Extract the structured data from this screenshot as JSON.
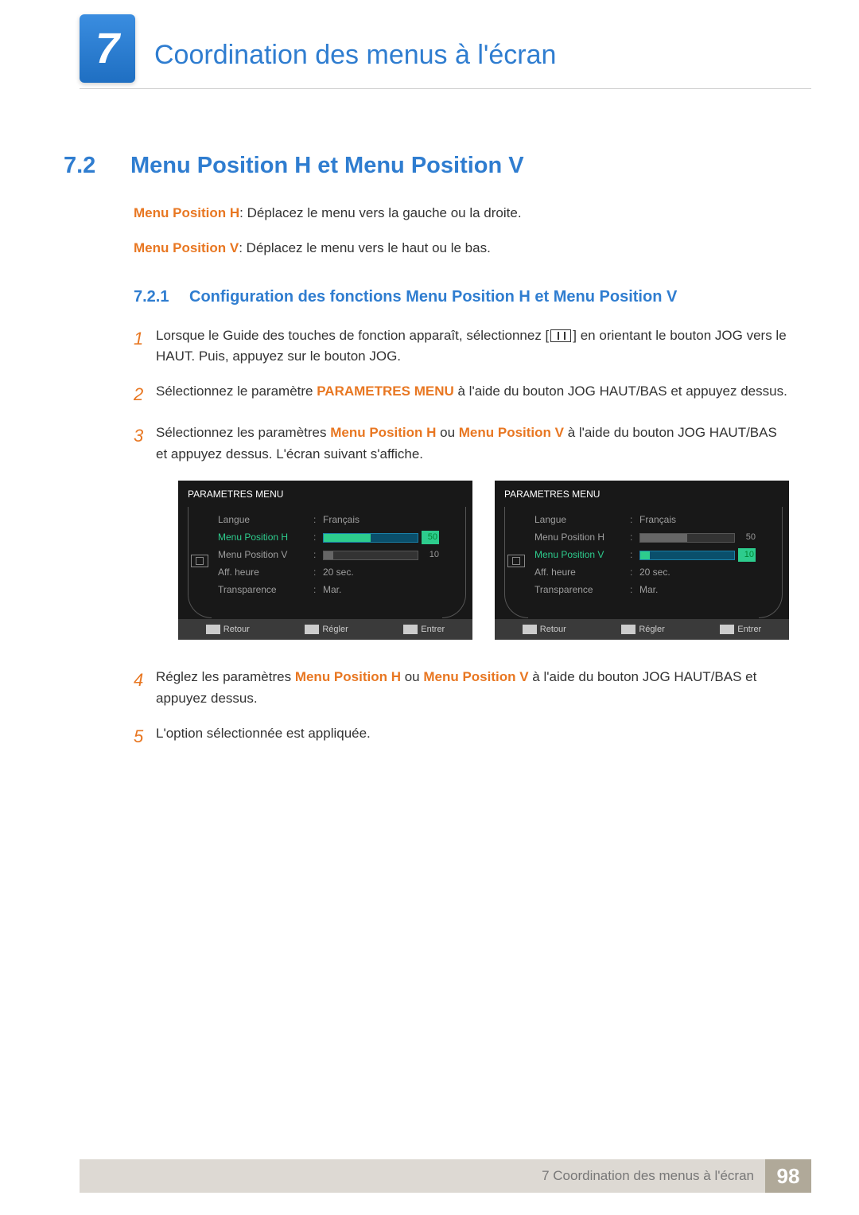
{
  "chapter": {
    "number": "7",
    "title": "Coordination des menus à l'écran"
  },
  "section": {
    "number": "7.2",
    "title": "Menu Position H et Menu Position V"
  },
  "defs": {
    "h_label": "Menu Position H",
    "h_text": ": Déplacez le menu vers la gauche ou la droite.",
    "v_label": "Menu Position V",
    "v_text": ": Déplacez le menu vers le haut ou le bas."
  },
  "subsection": {
    "number": "7.2.1",
    "title": "Configuration des fonctions Menu Position H et Menu Position V"
  },
  "steps": {
    "s1a": "Lorsque le Guide des touches de fonction apparaît, sélectionnez [",
    "s1b": "] en orientant le bouton JOG vers le HAUT. Puis, appuyez sur le bouton JOG.",
    "s2a": "Sélectionnez le paramètre ",
    "s2b": "PARAMETRES MENU",
    "s2c": " à l'aide du bouton JOG HAUT/BAS et appuyez dessus.",
    "s3a": "Sélectionnez les paramètres ",
    "s3b": "Menu Position H",
    "s3c": " ou ",
    "s3d": "Menu Position V",
    "s3e": " à l'aide du bouton JOG HAUT/BAS et appuyez dessus. L'écran suivant s'affiche.",
    "s4a": "Réglez les paramètres ",
    "s4b": "Menu Position H",
    "s4c": " ou ",
    "s4d": "Menu Position V",
    "s4e": " à l'aide du bouton JOG HAUT/BAS et appuyez dessus.",
    "s5": "L'option sélectionnée est appliquée."
  },
  "osd": {
    "title": "PARAMETRES MENU",
    "rows": {
      "langue": "Langue",
      "h": "Menu Position H",
      "v": "Menu Position V",
      "aff": "Aff. heure",
      "trans": "Transparence"
    },
    "values": {
      "langue": "Français",
      "h": "50",
      "v": "10",
      "aff": "20 sec.",
      "trans": "Mar."
    },
    "footer": {
      "retour": "Retour",
      "regler": "Régler",
      "entrer": "Entrer"
    }
  },
  "footer": {
    "text": "7 Coordination des menus à l'écran",
    "page": "98"
  }
}
